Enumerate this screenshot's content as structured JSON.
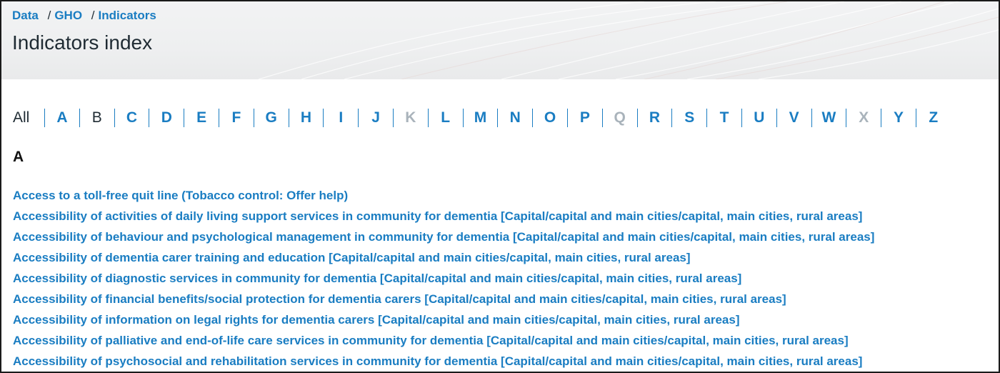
{
  "breadcrumb": [
    "Data",
    "GHO",
    "Indicators"
  ],
  "page_title": "Indicators index",
  "alphabet_nav": [
    {
      "label": "All",
      "state": "default"
    },
    {
      "label": "A",
      "state": "link"
    },
    {
      "label": "B",
      "state": "current"
    },
    {
      "label": "C",
      "state": "link"
    },
    {
      "label": "D",
      "state": "link"
    },
    {
      "label": "E",
      "state": "link"
    },
    {
      "label": "F",
      "state": "link"
    },
    {
      "label": "G",
      "state": "link"
    },
    {
      "label": "H",
      "state": "link"
    },
    {
      "label": "I",
      "state": "link"
    },
    {
      "label": "J",
      "state": "link"
    },
    {
      "label": "K",
      "state": "disabled"
    },
    {
      "label": "L",
      "state": "link"
    },
    {
      "label": "M",
      "state": "link"
    },
    {
      "label": "N",
      "state": "link"
    },
    {
      "label": "O",
      "state": "link"
    },
    {
      "label": "P",
      "state": "link"
    },
    {
      "label": "Q",
      "state": "disabled"
    },
    {
      "label": "R",
      "state": "link"
    },
    {
      "label": "S",
      "state": "link"
    },
    {
      "label": "T",
      "state": "link"
    },
    {
      "label": "U",
      "state": "link"
    },
    {
      "label": "V",
      "state": "link"
    },
    {
      "label": "W",
      "state": "link"
    },
    {
      "label": "X",
      "state": "disabled"
    },
    {
      "label": "Y",
      "state": "link"
    },
    {
      "label": "Z",
      "state": "link"
    }
  ],
  "section_heading": "A",
  "indicators": [
    "Access to a toll-free quit line (Tobacco control: Offer help)",
    "Accessibility of activities of daily living support services in community for dementia [Capital/capital and main cities/capital, main cities, rural areas]",
    "Accessibility of behaviour and psychological management in community for dementia [Capital/capital and main cities/capital, main cities, rural areas]",
    "Accessibility of dementia carer training and education [Capital/capital and main cities/capital, main cities, rural areas]",
    "Accessibility of diagnostic services in community for dementia [Capital/capital and main cities/capital, main cities, rural areas]",
    "Accessibility of financial benefits/social protection for dementia carers [Capital/capital and main cities/capital, main cities, rural areas]",
    "Accessibility of information on legal rights for dementia carers [Capital/capital and main cities/capital, main cities, rural areas]",
    "Accessibility of palliative and end-of-life care services in community for dementia [Capital/capital and main cities/capital, main cities, rural areas]",
    "Accessibility of psychosocial and rehabilitation services in community for dementia [Capital/capital and main cities/capital, main cities, rural areas]"
  ],
  "colors": {
    "link": "#1a7dc2",
    "text": "#1f2b33",
    "disabled": "#a9b3bb",
    "header_bg": "#eeeff0"
  }
}
